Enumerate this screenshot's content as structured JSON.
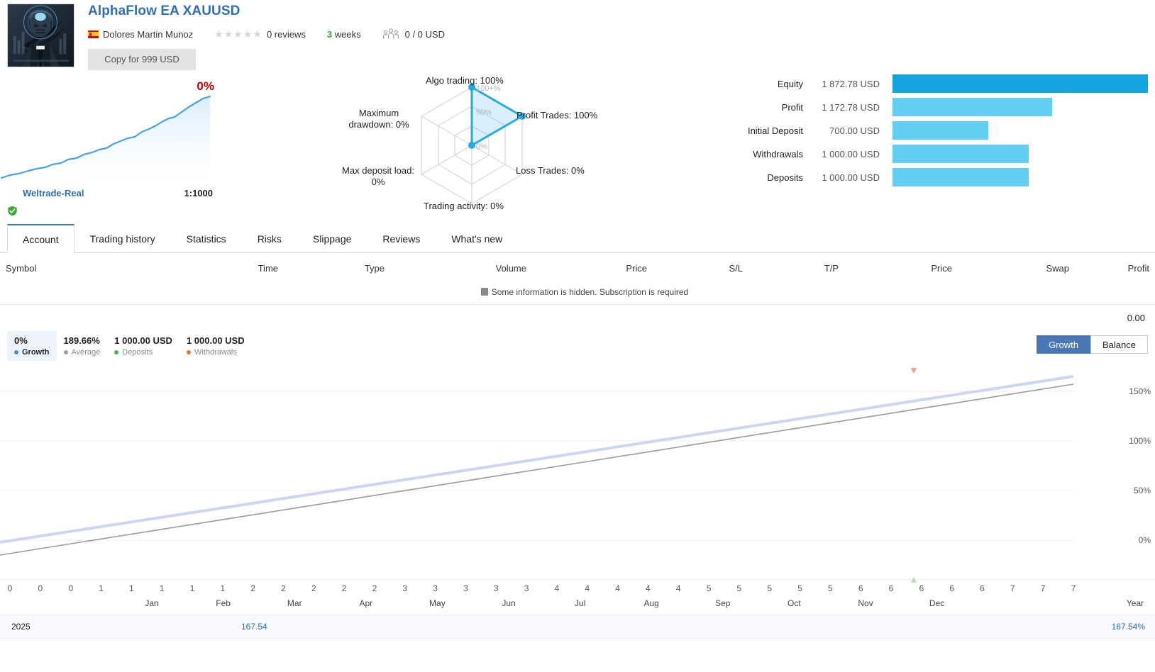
{
  "header": {
    "title": "AlphaFlow EA XAUUSD",
    "author": "Dolores Martin Munoz",
    "flag_icon": "spain-flag-icon",
    "rating_stars": 5,
    "reviews": "0 reviews",
    "weeks_number": "3",
    "weeks_label": "weeks",
    "subscribers": "0 / 0 USD",
    "copy_button": "Copy for 999 USD"
  },
  "mini_chart": {
    "growth_pct": "0%",
    "broker": "Weltrade-Real",
    "leverage": "1:1000",
    "verified_icon": "shield-check-icon"
  },
  "radar": {
    "labels": {
      "algo": "Algo trading: 100%",
      "profit_trades": "Profit Trades: 100%",
      "loss_trades": "Loss Trades: 0%",
      "trading_activity": "Trading activity: 0%",
      "max_deposit_load_line1": "Max deposit load:",
      "max_deposit_load_line2": "0%",
      "max_drawdown_line1": "Maximum",
      "max_drawdown_line2": "drawdown: 0%"
    },
    "rings": {
      "outer": "100+%",
      "mid": "50%",
      "inner": "0%"
    },
    "accent": "#2aa8e0"
  },
  "bars": {
    "accent_strong": "#17a3e0",
    "accent_light": "#63cdf2",
    "rows": [
      {
        "name": "Equity",
        "value": "1 872.78 USD",
        "pct": 100,
        "strong": true
      },
      {
        "name": "Profit",
        "value": "1 172.78 USD",
        "pct": 62.6,
        "strong": false
      },
      {
        "name": "Initial Deposit",
        "value": "700.00 USD",
        "pct": 37.4,
        "strong": false
      },
      {
        "name": "Withdrawals",
        "value": "1 000.00 USD",
        "pct": 53.4,
        "strong": false
      },
      {
        "name": "Deposits",
        "value": "1 000.00 USD",
        "pct": 53.4,
        "strong": false
      }
    ]
  },
  "tabs": [
    {
      "label": "Account",
      "active": true
    },
    {
      "label": "Trading history",
      "active": false
    },
    {
      "label": "Statistics",
      "active": false
    },
    {
      "label": "Risks",
      "active": false
    },
    {
      "label": "Slippage",
      "active": false
    },
    {
      "label": "Reviews",
      "active": false
    },
    {
      "label": "What's new",
      "active": false
    }
  ],
  "table": {
    "columns": [
      "Symbol",
      "Time",
      "Type",
      "Volume",
      "Price",
      "S/L",
      "T/P",
      "Price",
      "Swap",
      "Profit"
    ],
    "hidden_note": "Some information is hidden. Subscription is required",
    "total": "0.00"
  },
  "legend": [
    {
      "value": "0%",
      "label": "Growth",
      "color": "#3d8fd6",
      "selected": true
    },
    {
      "value": "189.66%",
      "label": "Average",
      "color": "#9a9a9a",
      "selected": false
    },
    {
      "value": "1 000.00 USD",
      "label": "Deposits",
      "color": "#4caf50",
      "selected": false
    },
    {
      "value": "1 000.00 USD",
      "label": "Withdrawals",
      "color": "#ef6c3a",
      "selected": false
    }
  ],
  "toggle": {
    "growth": "Growth",
    "balance": "Balance",
    "active": "Growth"
  },
  "footer": {
    "year": "2025",
    "value_mid": "167.54",
    "value_right": "167.54%"
  },
  "chart_data": {
    "type": "line",
    "title": "",
    "xlabel": "",
    "ylabel": "",
    "ylim": [
      -15,
      170
    ],
    "yticks": [
      0,
      50,
      100,
      150
    ],
    "ytick_labels": [
      "0%",
      "50%",
      "100%",
      "150%"
    ],
    "grid": true,
    "legend_position": "top-left",
    "x_week_ticks": [
      "0",
      "0",
      "0",
      "1",
      "1",
      "1",
      "1",
      "1",
      "2",
      "2",
      "2",
      "2",
      "2",
      "3",
      "3",
      "3",
      "3",
      "3",
      "4",
      "4",
      "4",
      "4",
      "4",
      "5",
      "5",
      "5",
      "5",
      "5",
      "6",
      "6",
      "6",
      "6",
      "6",
      "7",
      "7",
      "7"
    ],
    "x_month_ticks": [
      "Jan",
      "Feb",
      "Mar",
      "Apr",
      "May",
      "Jun",
      "Jul",
      "Aug",
      "Sep",
      "Oct",
      "Nov",
      "Dec",
      "Year"
    ],
    "series": [
      {
        "name": "Growth",
        "color": "#ccd6f2",
        "width": 4,
        "x": [
          0,
          100
        ],
        "values": [
          5,
          162
        ]
      },
      {
        "name": "Average",
        "color": "#9a9a9a",
        "width": 1.5,
        "x": [
          0,
          100
        ],
        "values": [
          -8,
          155
        ]
      }
    ],
    "markers": [
      {
        "name": "withdrawal-marker",
        "x_pct": 82.1,
        "position": "top",
        "color": "#f3a08a"
      },
      {
        "name": "deposit-marker",
        "x_pct": 82.1,
        "position": "bottom",
        "color": "#b9e0b0"
      }
    ]
  }
}
